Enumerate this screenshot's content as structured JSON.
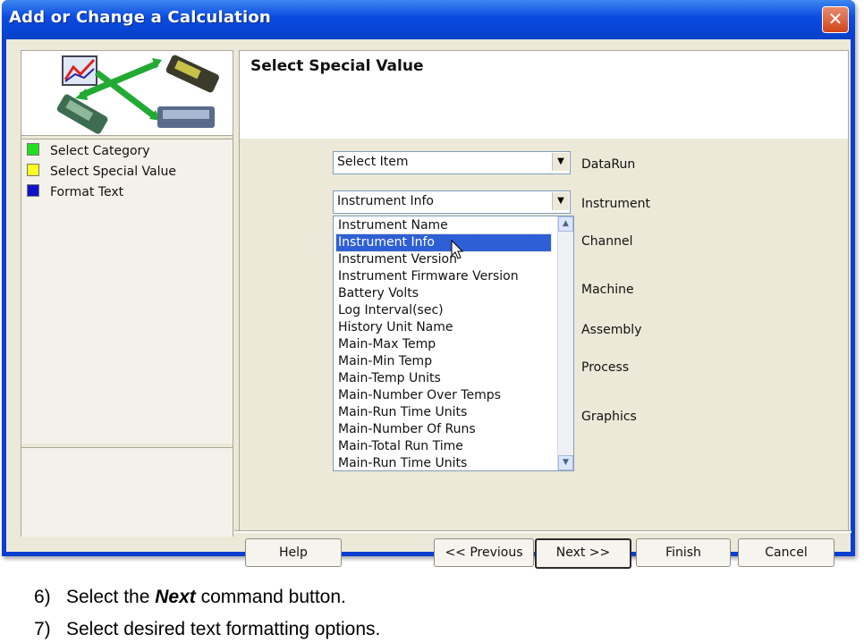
{
  "window": {
    "title": "Add or Change a Calculation",
    "close_glyph": "✕"
  },
  "left": {
    "steps": [
      {
        "label": "Select Category",
        "color": "#22dd22"
      },
      {
        "label": "Select Special Value",
        "color": "#ffff22"
      },
      {
        "label": "Format Text",
        "color": "#1111cc"
      }
    ]
  },
  "main": {
    "heading": "Select Special Value",
    "combo1": {
      "value": "Select Item",
      "arrow_icon": "chevron-down"
    },
    "combo2": {
      "value": "Instrument Info",
      "arrow_icon": "chevron-down"
    },
    "list": {
      "items": [
        "Instrument Name",
        "Instrument Info",
        "Instrument Version",
        "Instrument Firmware Version",
        "Battery Volts",
        "Log Interval(sec)",
        "History Unit Name",
        "Main-Max Temp",
        "Main-Min Temp",
        "Main-Temp Units",
        "Main-Number Over Temps",
        "Main-Run Time Units",
        "Main-Number Of Runs",
        "Main-Total Run Time",
        "Main-Run Time Units"
      ],
      "selected_index": 1
    },
    "categories": [
      "DataRun",
      "Instrument",
      "Channel",
      "Machine",
      "Assembly",
      "Process",
      "Graphics"
    ]
  },
  "buttons": {
    "help": "Help",
    "previous": "<< Previous",
    "next": "Next >>",
    "finish": "Finish",
    "cancel": "Cancel"
  },
  "instructions": [
    {
      "num": "6)",
      "before": "Select the ",
      "emph": "Next",
      "after": " command button."
    },
    {
      "num": "7)",
      "text": "Select desired text formatting options."
    }
  ]
}
